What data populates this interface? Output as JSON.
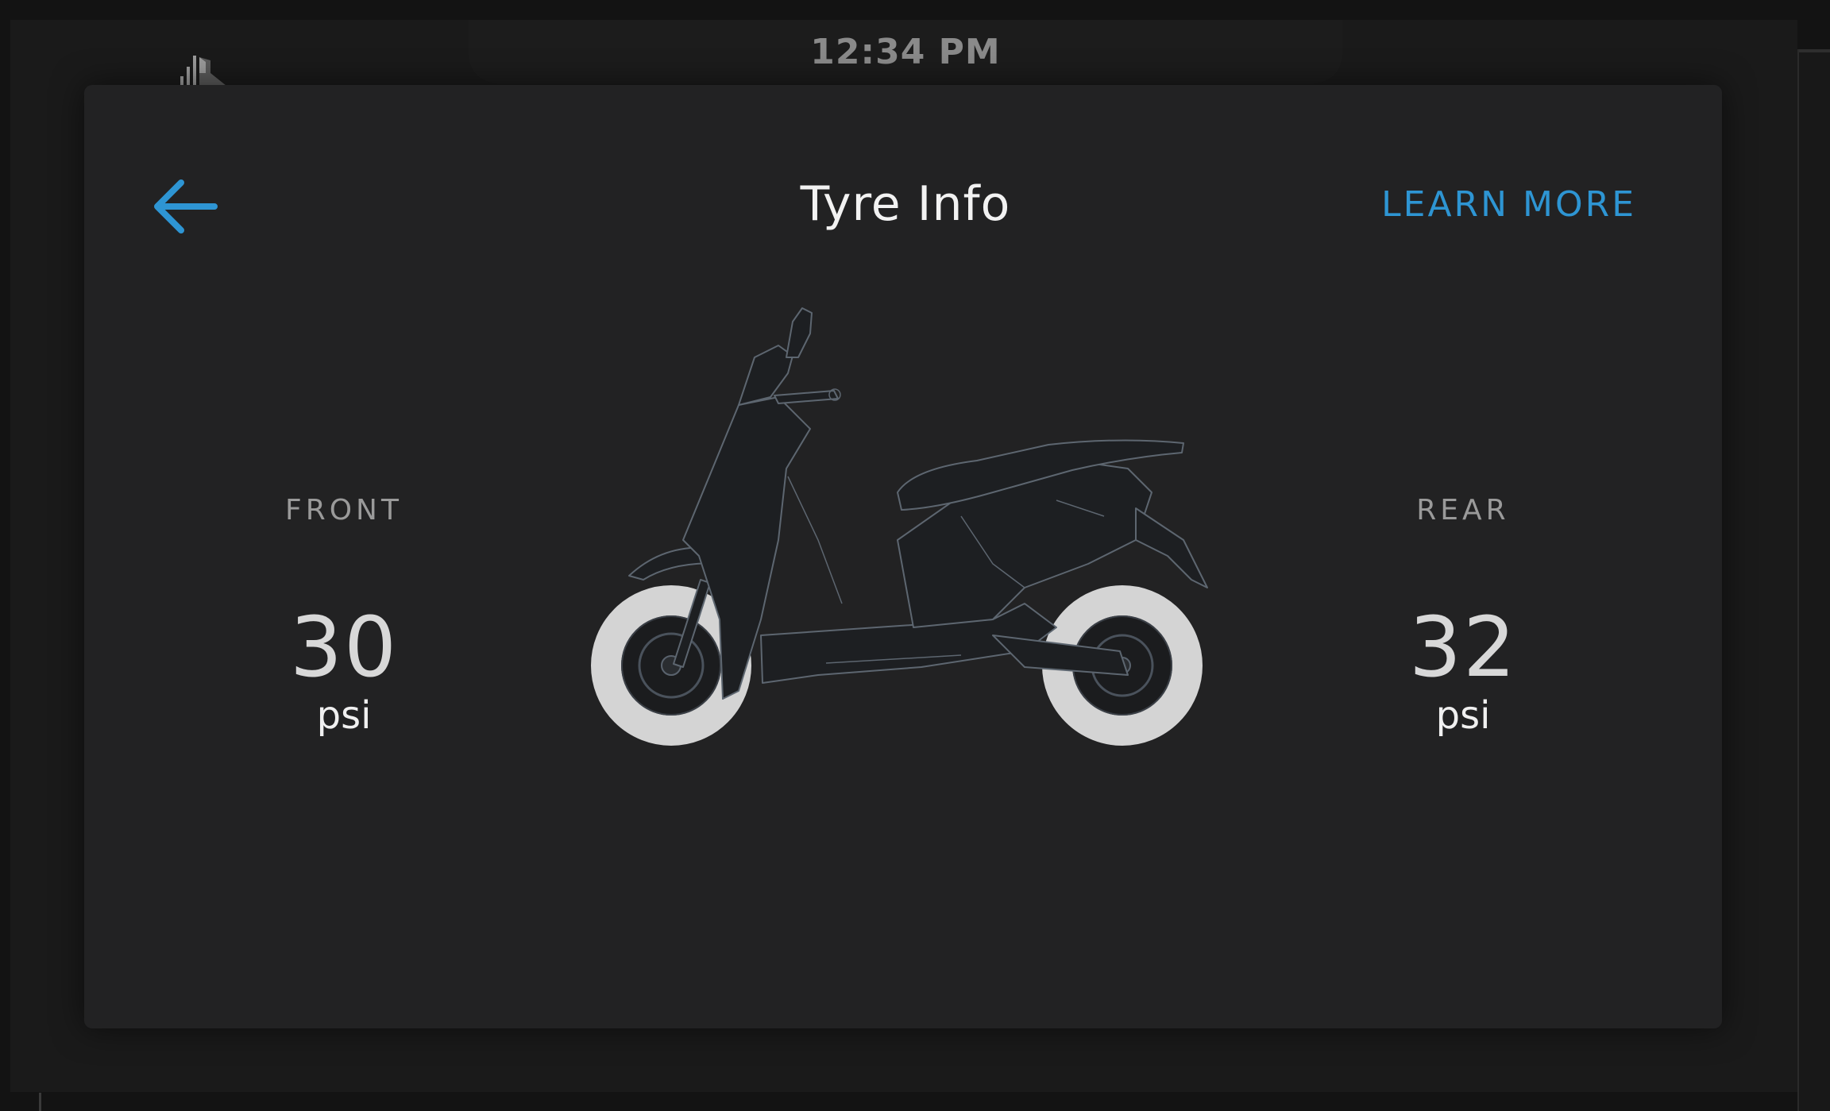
{
  "status_bar": {
    "time": "12:34 PM",
    "left_icon": "signal-icon"
  },
  "header": {
    "back_icon": "arrow-left-icon",
    "title": "Tyre Info",
    "learn_more_label": "LEARN MORE"
  },
  "tyres": {
    "front": {
      "label": "FRONT",
      "value": "30",
      "unit": "psi"
    },
    "rear": {
      "label": "REAR",
      "value": "32",
      "unit": "psi"
    }
  },
  "illustration": {
    "icon": "scooter-illustration"
  },
  "colors": {
    "accent": "#2e95d3",
    "panel": "#222223",
    "tyre_highlight": "#d4d4d4"
  }
}
